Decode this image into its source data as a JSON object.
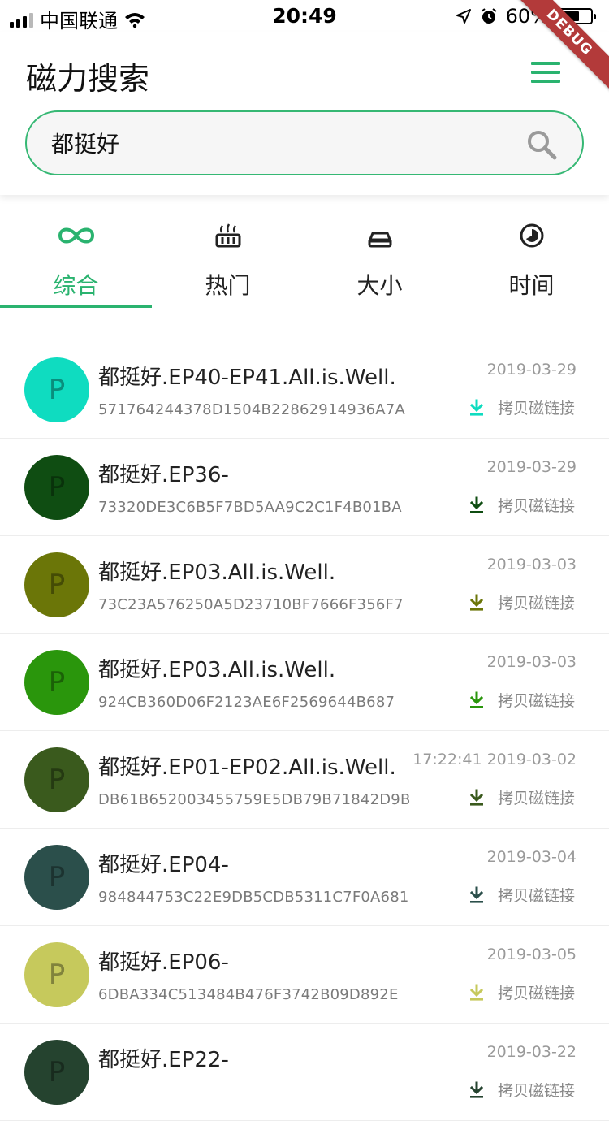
{
  "status_bar": {
    "carrier": "中国联通",
    "time": "20:49",
    "battery": "60%"
  },
  "debug_banner": "DEBUG",
  "header": {
    "title": "磁力搜索",
    "search_value": "都挺好"
  },
  "tabs": [
    {
      "label": "综合",
      "icon": "infinity-icon",
      "active": true
    },
    {
      "label": "热门",
      "icon": "fire-icon",
      "active": false
    },
    {
      "label": "大小",
      "icon": "disk-icon",
      "active": false
    },
    {
      "label": "时间",
      "icon": "clock-icon",
      "active": false
    }
  ],
  "colors": {
    "accent": "#2ab36f"
  },
  "copy_label": "拷贝磁链接",
  "results": [
    {
      "avatar_letter": "P",
      "avatar_color": "#0fdcc0",
      "title": "都挺好.EP40-EP41.All.is.Well.",
      "hash": "571764244378D1504B22862914936A7A",
      "date": "2019-03-29"
    },
    {
      "avatar_letter": "P",
      "avatar_color": "#0f4d12",
      "title": "都挺好.EP36-",
      "hash": "73320DE3C6B5F7BD5AA9C2C1F4B01BA",
      "date": "2019-03-29"
    },
    {
      "avatar_letter": "P",
      "avatar_color": "#6b7608",
      "title": "都挺好.EP03.All.is.Well.",
      "hash": "73C23A576250A5D23710BF7666F356F7",
      "date": "2019-03-03"
    },
    {
      "avatar_letter": "P",
      "avatar_color": "#2a960c",
      "title": "都挺好.EP03.All.is.Well.",
      "hash": "924CB360D06F2123AE6F2569644B687",
      "date": "2019-03-03"
    },
    {
      "avatar_letter": "P",
      "avatar_color": "#3a5a1d",
      "title": "都挺好.EP01-EP02.All.is.Well.",
      "hash": "DB61B652003455759E5DB79B71842D9B",
      "date": "17:22:41 2019-03-02"
    },
    {
      "avatar_letter": "P",
      "avatar_color": "#2b4f4b",
      "title": "都挺好.EP04-",
      "hash": "984844753C22E9DB5CDB5311C7F0A681",
      "date": "2019-03-04"
    },
    {
      "avatar_letter": "P",
      "avatar_color": "#c6c95c",
      "title": "都挺好.EP06-",
      "hash": "6DBA334C513484B476F3742B09D892E",
      "date": "2019-03-05"
    },
    {
      "avatar_letter": "P",
      "avatar_color": "#25432f",
      "title": "都挺好.EP22-",
      "hash": "",
      "date": "2019-03-22"
    }
  ]
}
